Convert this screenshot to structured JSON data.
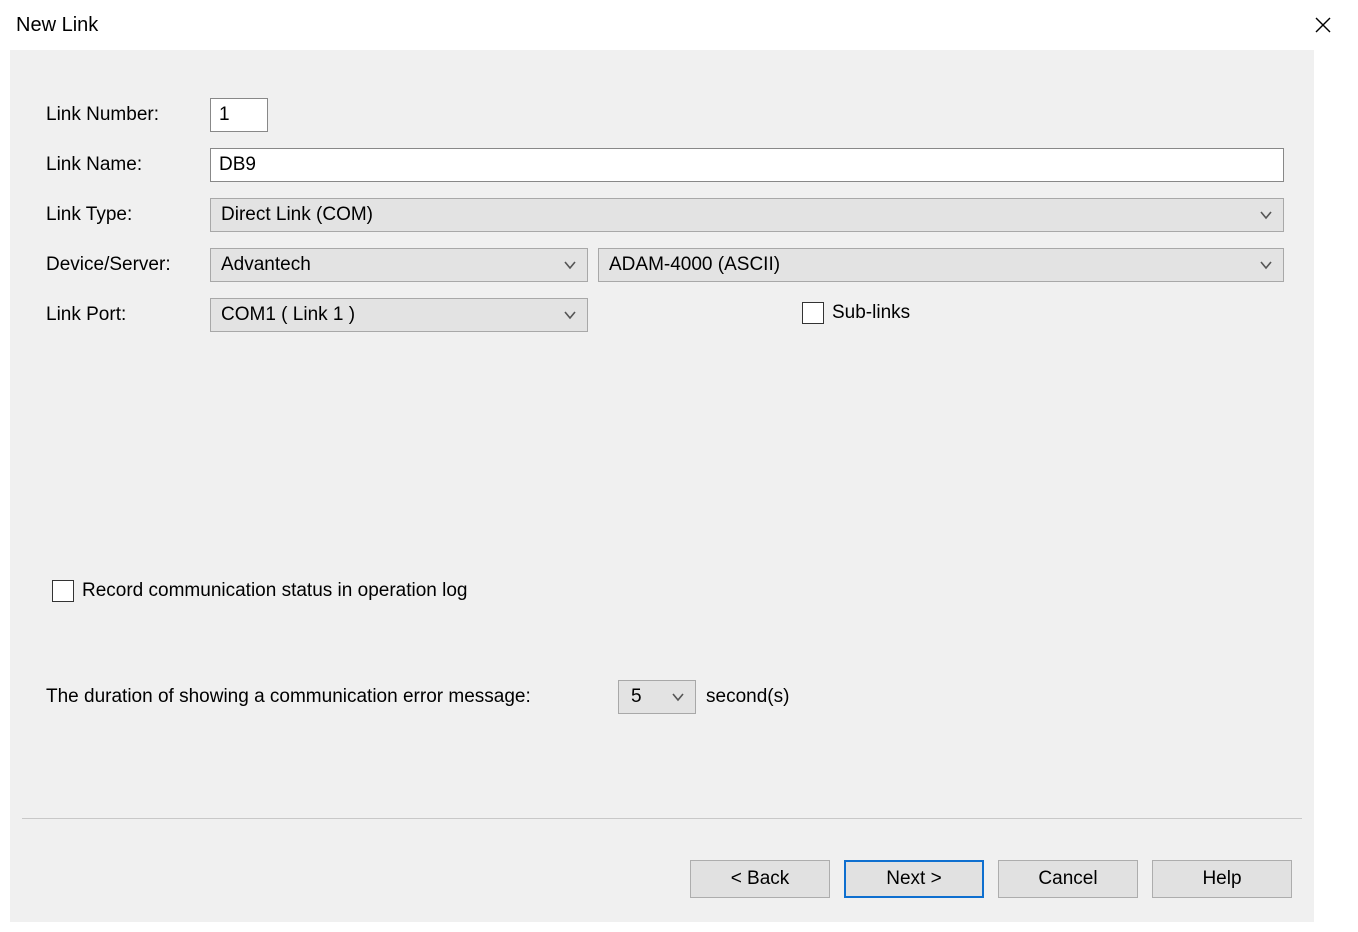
{
  "window": {
    "title": "New Link"
  },
  "labels": {
    "link_number": "Link Number:",
    "link_name": "Link Name:",
    "link_type": "Link Type:",
    "device_server": "Device/Server:",
    "link_port": "Link Port:",
    "sub_links": "Sub-links",
    "record_log": "Record communication status in operation log",
    "duration_msg": "The duration of showing a communication error message:",
    "seconds_suffix": "second(s)"
  },
  "values": {
    "link_number": "1",
    "link_name": "DB9",
    "link_type": "Direct Link (COM)",
    "device": "Advantech",
    "server": "ADAM-4000 (ASCII)",
    "link_port": "COM1 ( Link 1 )",
    "sub_links_checked": false,
    "record_log_checked": false,
    "duration": "5"
  },
  "buttons": {
    "back": "< Back",
    "next": "Next >",
    "cancel": "Cancel",
    "help": "Help"
  }
}
